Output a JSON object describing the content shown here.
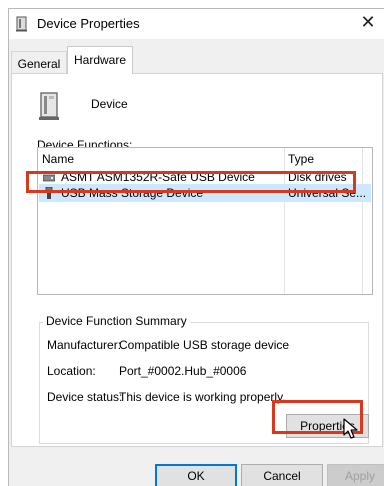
{
  "window": {
    "title": "Device Properties",
    "close_glyph": "✕"
  },
  "tabs": [
    {
      "label": "General"
    },
    {
      "label": "Hardware"
    }
  ],
  "device": {
    "name": "Device",
    "icon": "device-icon"
  },
  "functions": {
    "label": "Device Functions:",
    "columns": [
      "Name",
      "Type"
    ],
    "rows": [
      {
        "name": "ASMT ASM1352R-Safe USB Device",
        "type": "Disk drives",
        "icon": "disk-drive-icon",
        "selected": false
      },
      {
        "name": "USB Mass Storage Device",
        "type": "Universal Se...",
        "icon": "usb-icon",
        "selected": true
      }
    ]
  },
  "summary": {
    "title": "Device Function Summary",
    "manufacturer_label": "Manufacturer:",
    "manufacturer_value": "Compatible USB storage device",
    "location_label": "Location:",
    "location_value": "Port_#0002.Hub_#0006",
    "status_label": "Device status:",
    "status_value": "This device is working properly."
  },
  "buttons": {
    "properties": "Properties",
    "ok": "OK",
    "cancel": "Cancel",
    "apply": "Apply"
  },
  "colors": {
    "highlight": "#d9381e",
    "selection": "#cce8ff",
    "accent": "#0078d7"
  }
}
